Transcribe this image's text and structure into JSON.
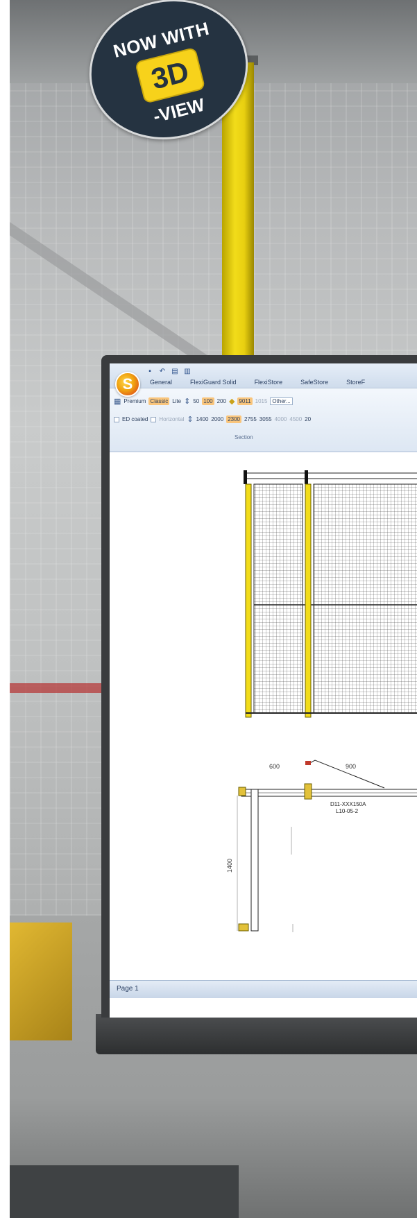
{
  "badge": {
    "line1": "NOW WITH",
    "chip": "3D",
    "line3": "-VIEW"
  },
  "app": {
    "logo_letter": "S",
    "tabs": [
      "General",
      "FlexiGuard Solid",
      "FlexiStore",
      "SafeStore",
      "StoreF"
    ],
    "ribbon": {
      "row1": {
        "variants": [
          "Premium",
          "Classic",
          "Lite"
        ],
        "selected_variant": "Classic",
        "widths": [
          "50",
          "100",
          "200"
        ],
        "selected_width": "100",
        "colors": [
          "9011",
          "1015",
          "Other..."
        ],
        "selected_color": "9011"
      },
      "row2": {
        "ed_coated": "ED coated",
        "horizontal": "Horizontal",
        "heights": [
          "1400",
          "2000",
          "2300",
          "2755",
          "3055",
          "4000",
          "4500",
          "20"
        ],
        "selected_height": "2300"
      },
      "section_label": "Section"
    },
    "drawing": {
      "dim_left": "600",
      "dim_right": "900",
      "dim_height": "1400",
      "part_code": "D11-XXX150A",
      "part_sub": "L10-05-2"
    },
    "status": "Page 1"
  },
  "colors": {
    "badge_bg": "#253341",
    "badge_chip": "#f7d21b",
    "post_yellow": "#f2dc1a",
    "ribbon_highlight": "#f9c57c"
  }
}
